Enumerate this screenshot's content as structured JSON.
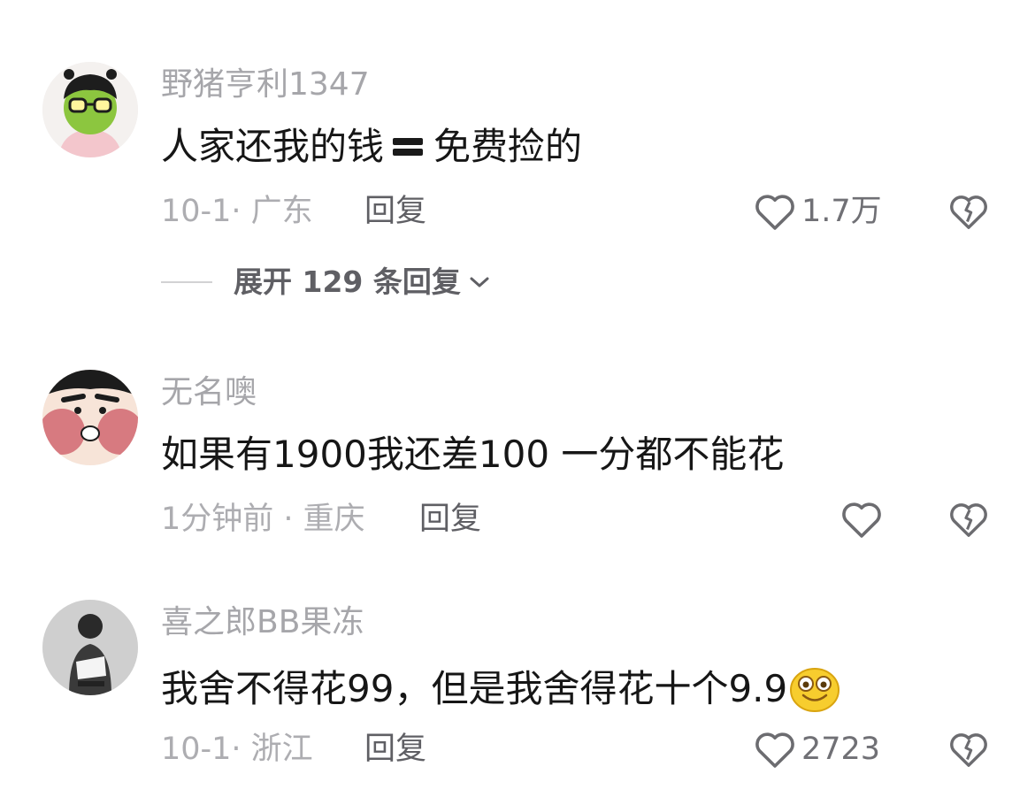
{
  "comments": [
    {
      "username": "野猪亨利1347",
      "text_before": "人家还我的钱",
      "text_icon": "equals-icon",
      "text_after": "免费捡的",
      "date": "10-1",
      "region": "广东",
      "meta": "10-1· 广东",
      "reply_label": "回复",
      "likes": "1.7万",
      "expand_label": "展开 129 条回复"
    },
    {
      "username": "无名噢",
      "text": "如果有1900我还差100 一分都不能花",
      "time": "1分钟前",
      "region": "重庆",
      "meta": "1分钟前 · 重庆",
      "reply_label": "回复",
      "likes": ""
    },
    {
      "username": "喜之郎BB果冻",
      "text": "我舍不得花99，但是我舍得花十个9.9",
      "text_icon": "smiley-emoji-icon",
      "date": "10-1",
      "region": "浙江",
      "meta": "10-1· 浙江",
      "reply_label": "回复",
      "likes": "2723"
    }
  ],
  "colors": {
    "username": "#a6a6aa",
    "content": "#161616",
    "meta": "#adadb1",
    "reply": "#5f5f64",
    "icon": "#6c6c70"
  }
}
